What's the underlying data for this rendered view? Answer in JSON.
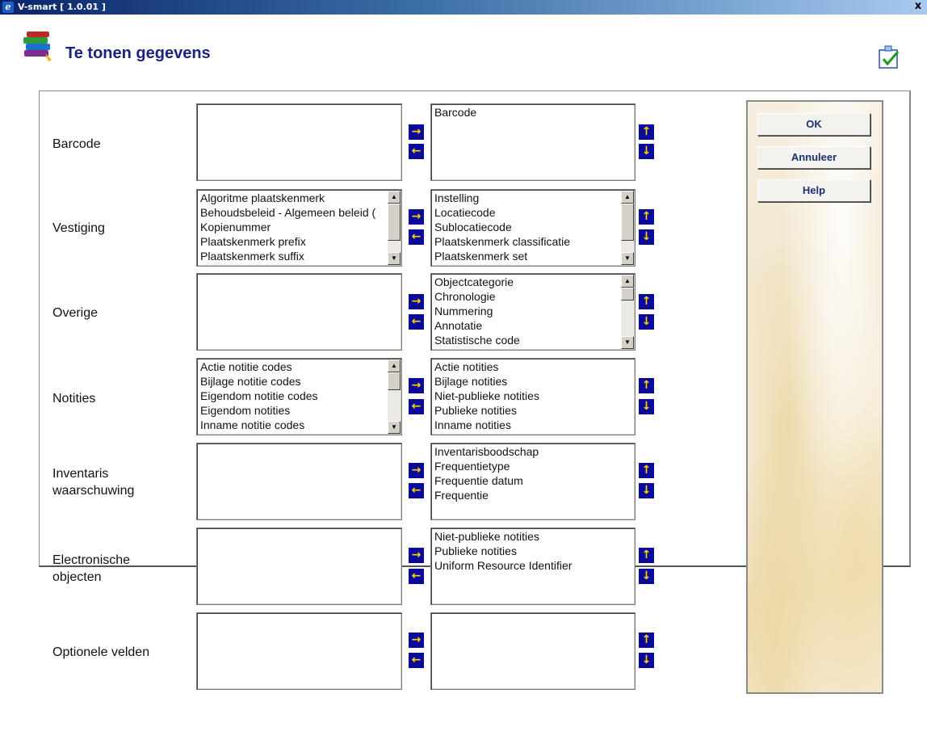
{
  "window": {
    "title": "V-smart [ 1.0.01 ]",
    "close_label": "x"
  },
  "page": {
    "title": "Te tonen gegevens"
  },
  "buttons": {
    "ok": "OK",
    "cancel": "Annuleer",
    "help": "Help"
  },
  "arrows": {
    "right": "→",
    "left": "←",
    "up": "↑",
    "down": "↓"
  },
  "rows": [
    {
      "label": "Barcode",
      "available": [],
      "selected": [
        "Barcode"
      ]
    },
    {
      "label": "Vestiging",
      "available": [
        "Algoritme plaatskenmerk",
        "Behoudsbeleid - Algemeen beleid (",
        "Kopienummer",
        "Plaatskenmerk prefix",
        "Plaatskenmerk suffix"
      ],
      "selected": [
        "Instelling",
        "Locatiecode",
        "Sublocatiecode",
        "Plaatskenmerk classificatie",
        "Plaatskenmerk set"
      ]
    },
    {
      "label": "Overige",
      "available": [],
      "selected": [
        "Objectcategorie",
        "Chronologie",
        "Nummering",
        "Annotatie",
        "Statistische code"
      ]
    },
    {
      "label": "Notities",
      "available": [
        "Actie notitie codes",
        "Bijlage notitie codes",
        "Eigendom notitie codes",
        "Eigendom notities",
        "Inname notitie codes"
      ],
      "selected": [
        "Actie notities",
        "Bijlage notities",
        "Niet-publieke notities",
        "Publieke notities",
        "Inname notities"
      ]
    },
    {
      "label_line1": "Inventaris",
      "label_line2": "waarschuwing",
      "available": [],
      "selected": [
        "Inventarisboodschap",
        "Frequentietype",
        "Frequentie datum",
        "Frequentie"
      ]
    },
    {
      "label_line1": "Electronische",
      "label_line2": "objecten",
      "available": [],
      "selected": [
        "Niet-publieke notities",
        "Publieke notities",
        "Uniform Resource Identifier"
      ]
    },
    {
      "label": "Optionele velden",
      "available": [],
      "selected": []
    }
  ]
}
